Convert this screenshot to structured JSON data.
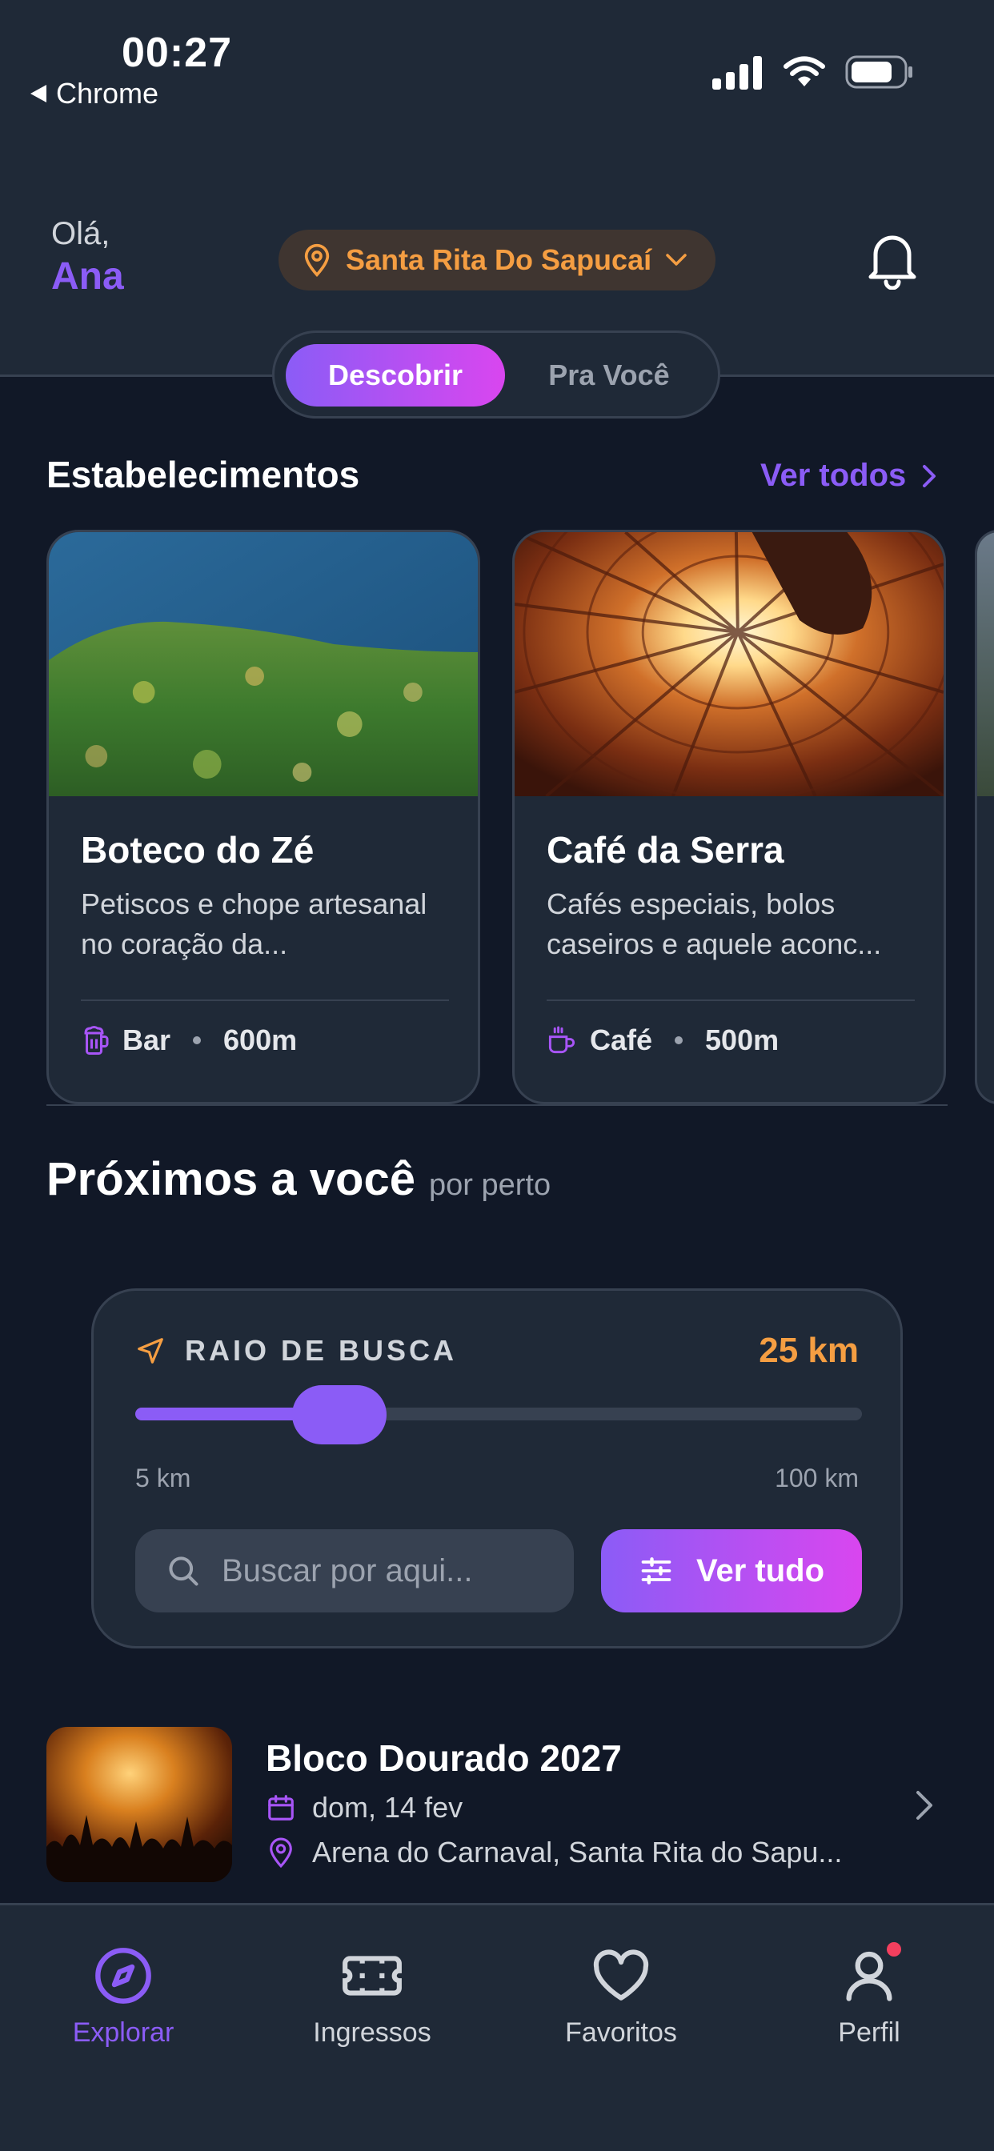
{
  "status_bar": {
    "time": "00:27",
    "back_app": "Chrome"
  },
  "header": {
    "greeting": "Olá,",
    "user_name": "Ana",
    "location": "Santa Rita Do Sapucaí",
    "icons": {
      "location": "map-pin-icon",
      "dropdown": "chevron-down-icon",
      "notifications": "bell-icon"
    }
  },
  "tabs": [
    {
      "label": "Descobrir",
      "active": true
    },
    {
      "label": "Pra Você",
      "active": false
    }
  ],
  "establishments": {
    "title": "Estabelecimentos",
    "see_all": "Ver todos",
    "items": [
      {
        "name": "Boteco do Zé",
        "description": "Petiscos e chope artesanal no coração da...",
        "category": "Bar",
        "distance": "600m",
        "icon": "beer-mug-icon"
      },
      {
        "name": "Café da Serra",
        "description": "Cafés especiais, bolos caseiros e aquele aconc...",
        "category": "Café",
        "distance": "500m",
        "icon": "coffee-cup-icon"
      }
    ]
  },
  "nearby": {
    "title": "Próximos a você",
    "subtitle": "por perto",
    "radius": {
      "label": "RAIO DE BUSCA",
      "value": "25 km",
      "min": "5 km",
      "max": "100 km",
      "level": 25
    },
    "search_placeholder": "Buscar por aqui...",
    "see_everything": "Ver tudo"
  },
  "event": {
    "title": "Bloco Dourado 2027",
    "date": "dom, 14 fev",
    "location": "Arena do Carnaval, Santa Rita do Sapu..."
  },
  "bottom_nav": [
    {
      "label": "Explorar",
      "icon": "compass-icon",
      "active": true
    },
    {
      "label": "Ingressos",
      "icon": "ticket-icon",
      "active": false
    },
    {
      "label": "Favoritos",
      "icon": "heart-icon",
      "active": false
    },
    {
      "label": "Perfil",
      "icon": "user-icon",
      "active": false,
      "badge": true
    }
  ],
  "colors": {
    "background": "#111827",
    "surface": "#1f2937",
    "accent": "#8b5cf6",
    "accent_end": "#d946ef",
    "orange": "#f59e42",
    "badge": "#f43f5e"
  }
}
